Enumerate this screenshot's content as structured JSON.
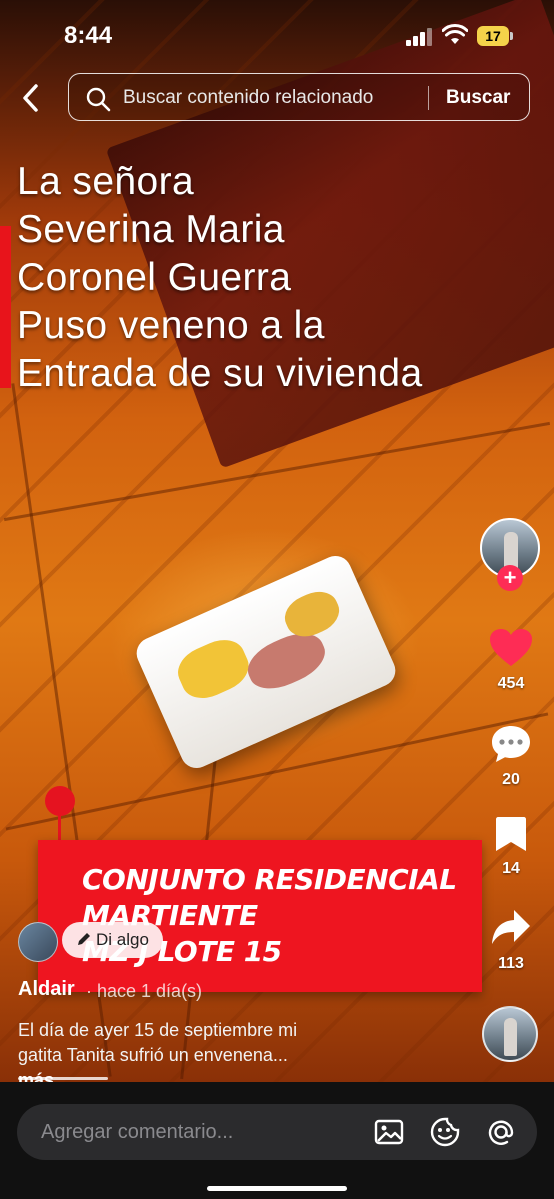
{
  "status_bar": {
    "time": "8:44",
    "battery": "17"
  },
  "search": {
    "placeholder": "Buscar contenido relacionado",
    "button": "Buscar"
  },
  "caption": {
    "lines": [
      "La señora",
      "Severina Maria",
      "Coronel Guerra",
      "Puso veneno a la",
      "Entrada de su vivienda"
    ]
  },
  "sticker": {
    "lines": [
      "CONJUNTO RESIDENCIAL",
      "MARTIENTE",
      "MZ J LOTE 15"
    ],
    "color": "#ee1520"
  },
  "rail": {
    "likes": "454",
    "comments": "20",
    "saves": "14",
    "shares": "113"
  },
  "post": {
    "reply_chip": "Di algo",
    "author": "Aldair",
    "meta": "· hace 1 día(s)",
    "desc_line1": "El día de ayer 15 de septiembre mi",
    "desc_line2": "gatita Tanita sufrió un envenena...",
    "more": " más"
  },
  "comment_bar": {
    "placeholder": "Agregar comentario..."
  },
  "colors": {
    "accent": "#fe2c55",
    "like": "#fe2c55",
    "sticker_red": "#ee1520"
  },
  "icons": [
    "chevron-left-icon",
    "search-icon",
    "heart-icon",
    "comment-icon",
    "bookmark-icon",
    "share-icon",
    "image-icon",
    "emoji-icon",
    "mention-icon",
    "pencil-icon",
    "plus-icon"
  ]
}
